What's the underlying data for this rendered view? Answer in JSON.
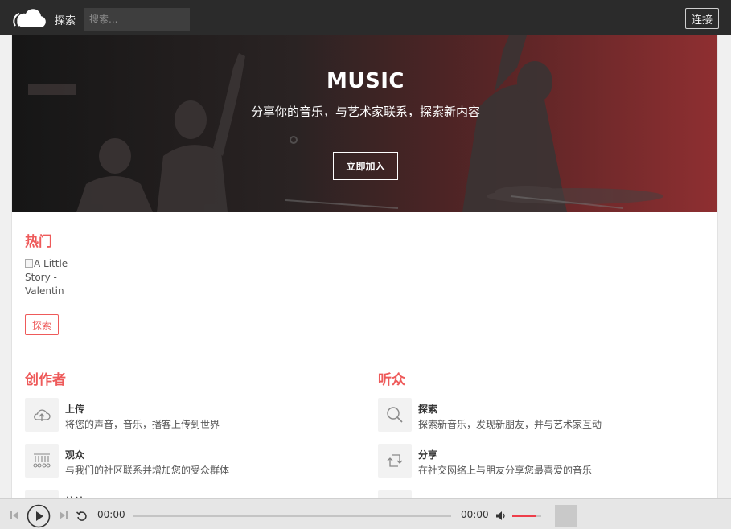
{
  "header": {
    "nav_explore": "探索",
    "search_placeholder": "搜索...",
    "connect_label": "连接"
  },
  "hero": {
    "title": "MUSIC",
    "subtitle": "分享你的音乐，与艺术家联系，探索新内容",
    "join_label": "立即加入"
  },
  "hot": {
    "title": "热门",
    "image_alt": "A Little Story - Valentin",
    "explore_label": "探索"
  },
  "creators": {
    "title": "创作者",
    "items": [
      {
        "icon": "upload-cloud-icon",
        "title": "上传",
        "desc": "将您的声音，音乐，播客上传到世界"
      },
      {
        "icon": "audience-icon",
        "title": "观众",
        "desc": "与我们的社区联系并增加您的受众群体"
      },
      {
        "icon": "stats-icon",
        "title": "统计",
        "desc": ""
      }
    ]
  },
  "listeners": {
    "title": "听众",
    "items": [
      {
        "icon": "search-icon",
        "title": "探索",
        "desc": "探索新音乐，发现新朋友，并与艺术家互动"
      },
      {
        "icon": "share-icon",
        "title": "分享",
        "desc": "在社交网络上与朋友分享您最喜爱的音乐"
      },
      {
        "icon": "listen-icon",
        "title": "",
        "desc": ""
      }
    ]
  },
  "player": {
    "current_time": "00:00",
    "duration": "00:00",
    "volume_fraction": 0.8,
    "progress_fraction": 0
  },
  "colors": {
    "accent": "#ee5a5a",
    "topbar": "#2b2b2b",
    "volume": "#ee3e4a"
  }
}
